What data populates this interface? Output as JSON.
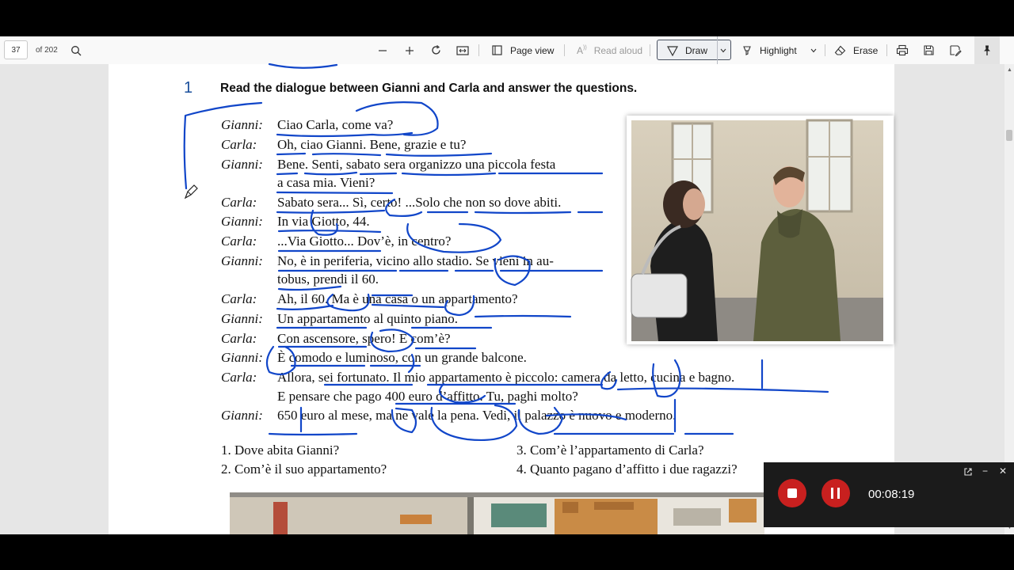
{
  "toolbar": {
    "page_number": "37",
    "page_total": "of 202",
    "page_view": "Page view",
    "read_aloud": "Read aloud",
    "draw": "Draw",
    "highlight": "Highlight",
    "erase": "Erase"
  },
  "icons": {
    "search": "search-icon",
    "zoom_out": "minus-icon",
    "zoom_in": "plus-icon",
    "rotate": "rotate-icon",
    "fit": "fit-page-icon",
    "page_view": "page-view-icon",
    "read_aloud": "read-aloud-icon",
    "draw": "pen-icon",
    "highlight": "highlighter-icon",
    "erase": "eraser-icon",
    "print": "print-icon",
    "save": "save-icon",
    "save_as": "save-as-icon",
    "pin": "pin-icon"
  },
  "colors": {
    "ink": "#1146c9",
    "exercise_number": "#1a4f9c",
    "record": "#c8201f",
    "recorder_bg": "#1b1b1b"
  },
  "exercise": {
    "number": "1",
    "title": "Read the dialogue between Gianni and Carla and answer the questions."
  },
  "dialogue": [
    {
      "speaker": "Gianni:",
      "text": "Ciao Carla, come va?"
    },
    {
      "speaker": "Carla:",
      "text": "Oh, ciao Gianni. Bene, grazie e tu?"
    },
    {
      "speaker": "Gianni:",
      "text": "Bene. Senti, sabato sera organizzo una piccola festa"
    },
    {
      "speaker": "",
      "text": "a casa mia. Vieni?"
    },
    {
      "speaker": "Carla:",
      "text": "Sabato sera... Sì, certo! ...Solo che non so dove abiti."
    },
    {
      "speaker": "Gianni:",
      "text": "In via Giotto, 44."
    },
    {
      "speaker": "Carla:",
      "text": "...Via Giotto... Dov’è, in centro?"
    },
    {
      "speaker": "Gianni:",
      "text": "No, è in periferia, vicino allo stadio. Se vieni in au-"
    },
    {
      "speaker": "",
      "text": "tobus, prendi il 60."
    },
    {
      "speaker": "Carla:",
      "text": "Ah, il 60. Ma è una casa o un appartamento?"
    },
    {
      "speaker": "Gianni:",
      "text": "Un appartamento al quinto piano."
    },
    {
      "speaker": "Carla:",
      "text": "Con ascensore, spero! E com’è?"
    },
    {
      "speaker": "Gianni:",
      "text": "È comodo e luminoso, con un grande balcone."
    },
    {
      "speaker": "Carla:",
      "text": "Allora, sei fortunato. Il mio appartamento è piccolo: camera da letto, cucina e bagno."
    },
    {
      "speaker": "",
      "text": "E pensare che pago 400 euro d’affitto. Tu, paghi molto?"
    },
    {
      "speaker": "Gianni:",
      "text": "650 euro al mese, ma ne vale la pena. Vedi, il palazzo è nuovo e moderno."
    }
  ],
  "questions": [
    "1. Dove abita Gianni?",
    "2. Com’è il suo appartamento?",
    "3. Com’è l’appartamento di Carla?",
    "4. Quanto pagano d’affitto i due ragazzi?"
  ],
  "recorder": {
    "time": "00:08:19"
  }
}
